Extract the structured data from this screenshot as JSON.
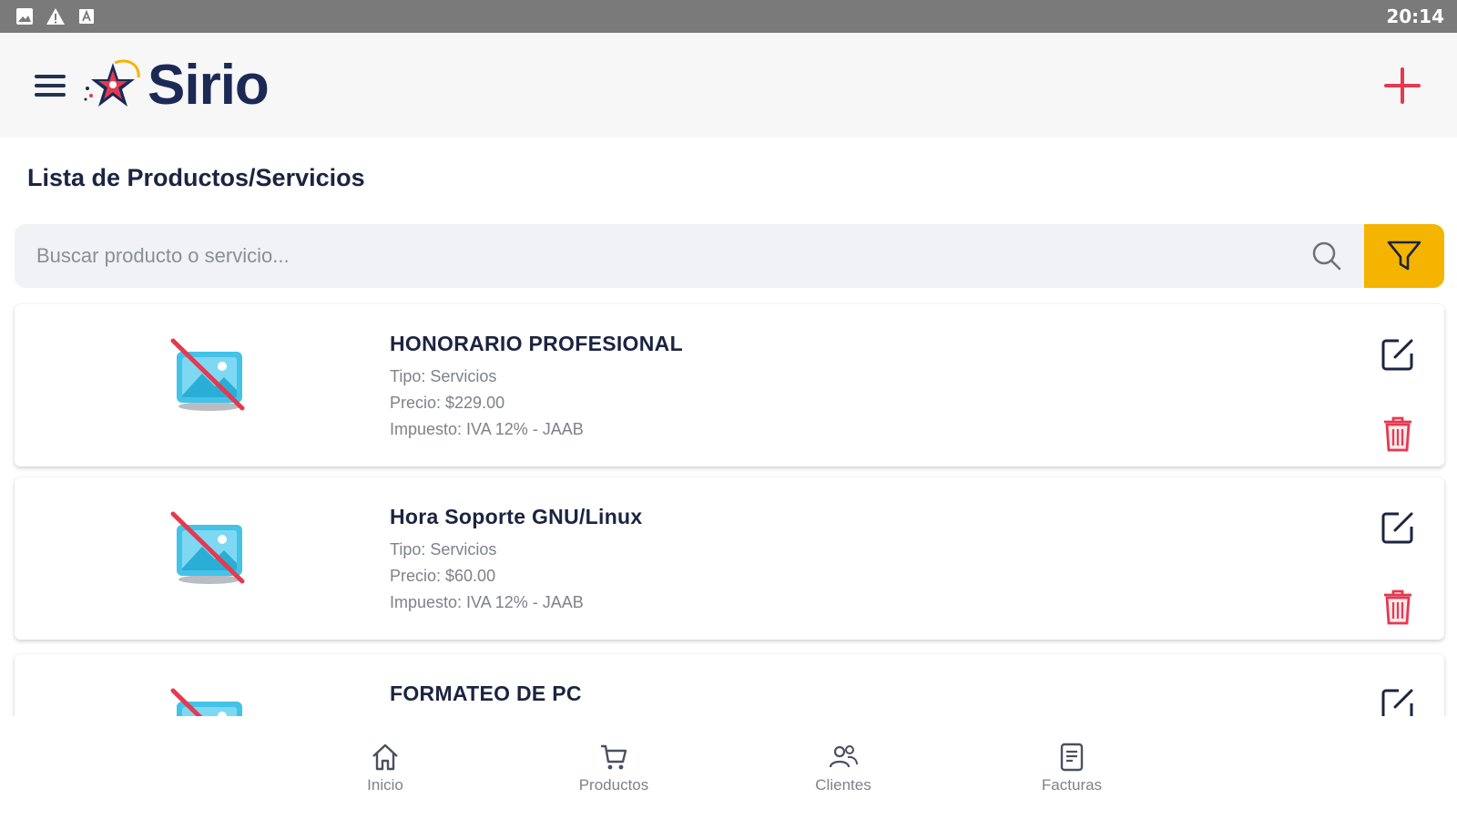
{
  "status_bar": {
    "time": "20:14",
    "icons": [
      "image-icon",
      "warning-icon",
      "a-box-icon"
    ]
  },
  "app_bar": {
    "logo_text": "Sirio",
    "menu_icon": "hamburger-menu-icon",
    "add_icon": "plus-icon",
    "accent_color": "#e53950"
  },
  "page": {
    "title": "Lista de Productos/Servicios"
  },
  "search": {
    "placeholder": "Buscar producto o servicio...",
    "value": "",
    "filter_color": "#f5b400"
  },
  "products": [
    {
      "name": "HONORARIO PROFESIONAL",
      "tipo": "Tipo: Servicios",
      "precio": "Precio: $229.00",
      "impuesto": "Impuesto: IVA 12% - JAAB"
    },
    {
      "name": "Hora Soporte GNU/Linux",
      "tipo": "Tipo: Servicios",
      "precio": "Precio: $60.00",
      "impuesto": "Impuesto: IVA 12% - JAAB"
    },
    {
      "name": "FORMATEO DE PC",
      "tipo": "",
      "precio": "",
      "impuesto": ""
    }
  ],
  "bottom_nav": [
    {
      "label": "Inicio",
      "icon": "home-icon"
    },
    {
      "label": "Productos",
      "icon": "cart-icon"
    },
    {
      "label": "Clientes",
      "icon": "users-icon"
    },
    {
      "label": "Facturas",
      "icon": "invoice-icon"
    }
  ]
}
